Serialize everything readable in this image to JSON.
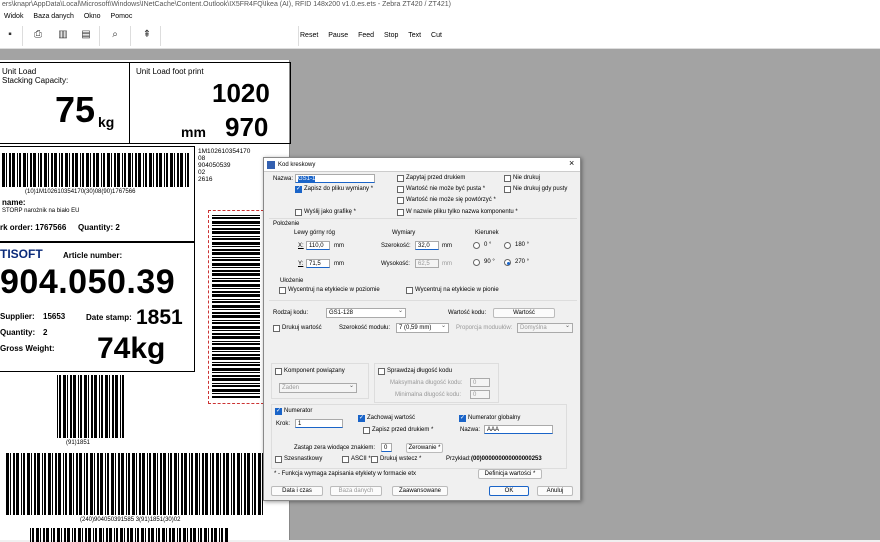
{
  "window": {
    "title": "ers\\knapr\\AppData\\Local\\Microsoft\\Windows\\INetCache\\Content.Outlook\\IX5FR4FQ\\Ikea (AI), RFID 148x200 v1.0.es.ets - Zebra ZT420 / ZT421)"
  },
  "menu": [
    "Widok",
    "Baza danych",
    "Okno",
    "Pomoc"
  ],
  "commands": [
    "Reset",
    "Pause",
    "Feed",
    "Stop",
    "Text",
    "Cut"
  ],
  "label": {
    "unit_load_capacity": [
      "Unit Load",
      "Stacking Capacity:"
    ],
    "capacity_value": "75",
    "capacity_unit": "kg",
    "footprint_title": "Unit Load foot print",
    "footprint_1": "1020",
    "footprint_unit": "mm",
    "footprint_2": "970",
    "barcode1_text": "(10)1M102610354170(30)08(90)1767566",
    "name_label": "name:",
    "name_value": "STORP narożnik na biało EU",
    "work_order": "rk order:  1767566",
    "quantity_top": "Quantity: 2",
    "side_lines": [
      "1M102610354170",
      "08",
      "904050539",
      "02",
      "2616"
    ],
    "brand": "TISOFT",
    "article_label": "Article number:",
    "article_value": "904.050.39",
    "supplier_label": "Supplier:",
    "supplier_value": "15653",
    "date_label": "Date stamp:",
    "date_value": "1851",
    "quantity_label": "Quantity:",
    "quantity_value": "2",
    "gross_label": "Gross Weight:",
    "gross_value": "74kg",
    "barcode2_text": "(91)1851",
    "barcode3_text": "(240)904050391585 3(91)1851(30)02"
  },
  "dialog": {
    "title": "Kod kreskowy",
    "close": "×",
    "name_label": "Nazwa:",
    "name_value": "GS1-1",
    "save_file": "Zapisz do pliku wymiany *",
    "send_graphic": "Wyślij jako grafikę *",
    "ask_before_print": "Zapytaj przed drukiem",
    "not_empty": "Wartość nie może być pusta *",
    "not_repeat": "Wartość nie może się powtórzyć *",
    "file_name_only": "W nazwie pliku tylko nazwa komponentu *",
    "no_print": "Nie drukuj",
    "no_print_empty": "Nie drukuj gdy pusty",
    "position_group": "Położenie",
    "top_left": "Lewy górny róg",
    "x_label": "X:",
    "x_value": "110,0",
    "y_label": "Y:",
    "y_value": "71,5",
    "unit_mm": "mm",
    "dims_group": "Wymiary",
    "width_label": "Szerokość:",
    "width_value": "32,0",
    "height_label": "Wysokość:",
    "height_value": "62,5",
    "direction_group": "Kierunek",
    "dir_0": "0 °",
    "dir_180": "180 °",
    "dir_90": "90 °",
    "dir_270": "270 °",
    "alignment_group": "Ułożenie",
    "center_h": "Wycentruj na etykiecie w poziomie",
    "center_v": "Wycentruj na etykiecie w pionie",
    "code_type_label": "Rodzaj kodu:",
    "code_type_value": "GS1-128",
    "code_value_label": "Wartość kodu:",
    "code_value_btn": "Wartość",
    "print_value": "Drukuj wartość",
    "module_width_label": "Szerokość modułu:",
    "module_width_value": "7 (0,59 mm)",
    "ratio_label": "Proporcja moduułów:",
    "ratio_value": "Domyślna",
    "linked_component": "Komponent powiązany",
    "linked_value": "Żaden",
    "check_length": "Sprawdzaj długość kodu",
    "max_length": "Maksymalna długość kodu:",
    "max_value": "0",
    "min_length": "Minimalna długość kodu:",
    "min_value": "0",
    "counter": "Numerator",
    "keep_value": "Zachowaj wartość",
    "save_before_print": "Zapisz przed drukiem *",
    "global_counter": "Numerator globalny",
    "step_label": "Krok:",
    "step_value": "1",
    "global_name_label": "Nazwa:",
    "global_name_value": "AAA",
    "leading_zeros": "Zastąp zera wiodące znakiem:",
    "leading_zero_value": "0",
    "reset_btn": "Zerowanie *",
    "hex": "Szesnastkowy",
    "ascii": "ASCII *",
    "print_reverse": "Drukuj wstecz *",
    "example_label": "Przykład:",
    "example_value": "(00)000000000000000253",
    "footnote": "* - Funkcja wymaga zapisania etykiety w formacie etx",
    "define_value_btn": "Definicja wartości *",
    "date_time_btn": "Data i czas",
    "database_btn": "Baza danych",
    "advanced_btn": "Zaawansowane",
    "ok_btn": "OK",
    "cancel_btn": "Anuluj"
  }
}
